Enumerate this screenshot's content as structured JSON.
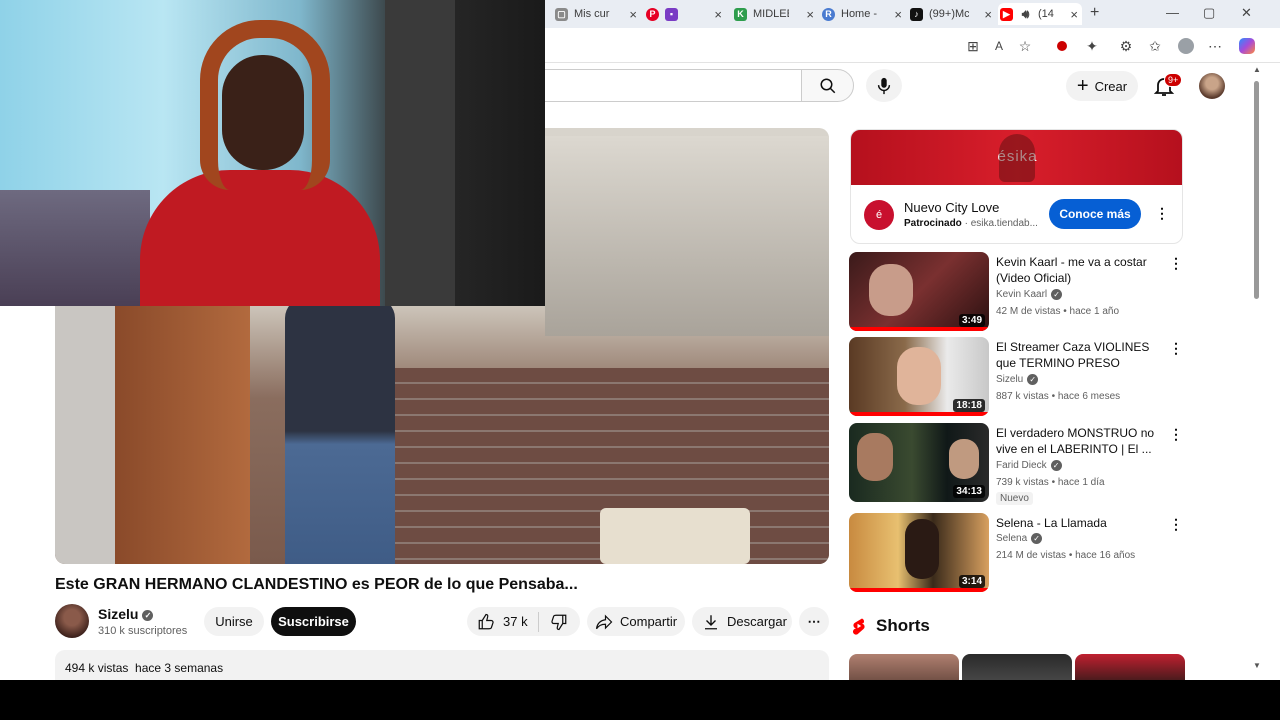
{
  "browser": {
    "tabs": [
      {
        "label": "Mis curs",
        "color": "#8a8a8a",
        "glyph": "▢"
      },
      {
        "label": "",
        "color": "#e60023",
        "glyph": "P"
      },
      {
        "label": "MIDLEE",
        "color": "#2e9d4d",
        "glyph": "K"
      },
      {
        "label": "Home -",
        "color": "#4a7bd0",
        "glyph": "R"
      },
      {
        "label": "(99+)Mc",
        "color": "#111111",
        "glyph": "♪"
      },
      {
        "label": "(14",
        "color": "#ff0000",
        "glyph": "▶"
      }
    ],
    "new_tab": "+",
    "window_controls": [
      "—",
      "▢",
      "✕"
    ]
  },
  "header": {
    "create_label": "Crear",
    "notif_badge": "9+"
  },
  "video": {
    "title": "Este GRAN HERMANO CLANDESTINO es PEOR de lo que Pensaba...",
    "channel": "Sizelu",
    "subscribers": "310 k suscriptores",
    "join_label": "Unirse",
    "subscribe_label": "Suscribirse",
    "likes": "37 k",
    "share_label": "Compartir",
    "download_label": "Descargar",
    "views": "494 k vistas",
    "published": "hace 3 semanas"
  },
  "ad": {
    "brand": "ésika",
    "title": "Nuevo City Love",
    "sponsored": "Patrocinado",
    "domain": "esika.tiendab...",
    "cta": "Conoce más"
  },
  "recommendations": [
    {
      "title": "Kevin Kaarl - me va a costar (Video Oficial)",
      "channel": "Kevin Kaarl",
      "views": "42 M de vistas",
      "age": "hace 1 año",
      "duration": "3:49",
      "badge": ""
    },
    {
      "title": "El Streamer Caza VIOLINES que TERMINO PRESO",
      "channel": "Sizelu",
      "views": "887 k vistas",
      "age": "hace 6 meses",
      "duration": "18:18",
      "badge": ""
    },
    {
      "title": "El verdadero MONSTRUO no vive en el LABERINTO | El ...",
      "channel": "Farid Dieck",
      "views": "739 k vistas",
      "age": "hace 1 día",
      "duration": "34:13",
      "badge": "Nuevo"
    },
    {
      "title": "Selena - La Llamada",
      "channel": "Selena",
      "views": "214 M de vistas",
      "age": "hace 16 años",
      "duration": "3:14",
      "badge": ""
    }
  ],
  "shorts": {
    "title": "Shorts"
  },
  "colors": {
    "accent_blue": "#065fd4",
    "youtube_red": "#ff0000",
    "ad_red": "#c8102e"
  }
}
